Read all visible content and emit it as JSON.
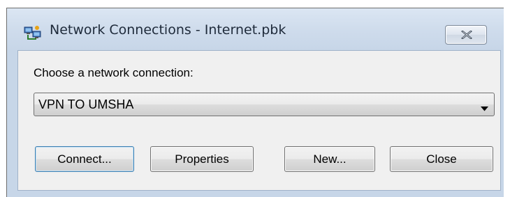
{
  "window": {
    "title": "Network Connections - Internet.pbk",
    "app_icon": "network-connections-icon",
    "close_icon": "close-icon"
  },
  "dialog": {
    "prompt_label": "Choose a network connection:",
    "connection_select": {
      "selected_value": "VPN TO UMSHA",
      "arrow_icon": "chevron-down-icon"
    },
    "buttons": {
      "connect": "Connect...",
      "properties": "Properties",
      "new": "New...",
      "close": "Close"
    }
  },
  "colors": {
    "title_gradient_top": "#dbe6f3",
    "client_background": "#f0f0f0",
    "default_button_border": "#3c7fb1"
  }
}
